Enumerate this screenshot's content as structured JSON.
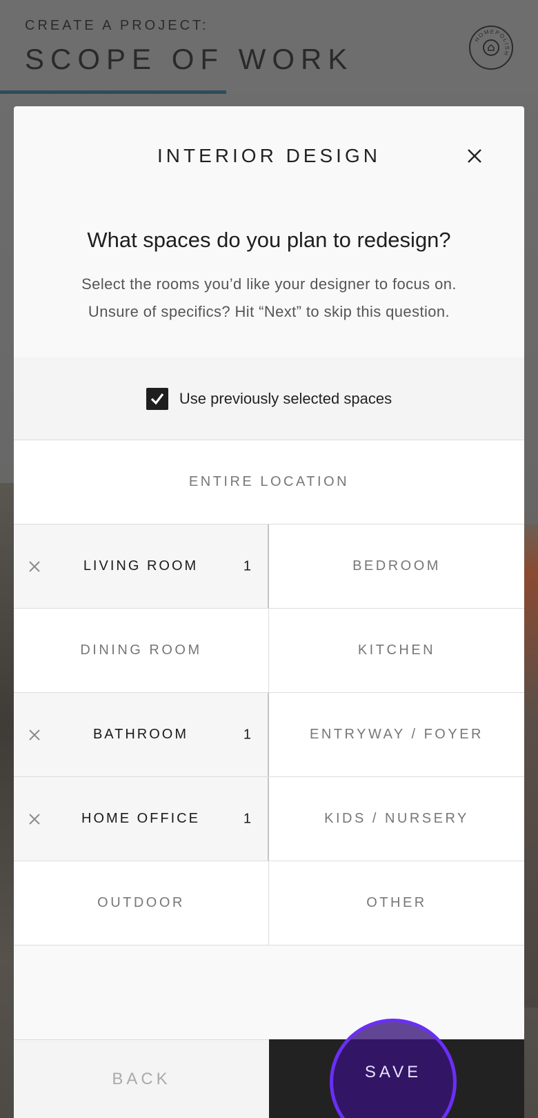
{
  "header": {
    "subtitle": "CREATE A PROJECT:",
    "title": "SCOPE OF WORK",
    "progress_fraction": 0.42,
    "logo_text": "HOMEPOLISH"
  },
  "modal": {
    "title": "INTERIOR DESIGN",
    "question": "What spaces do you plan to redesign?",
    "helper_line1": "Select the rooms you’d like your designer to focus on.",
    "helper_line2": "Unsure of specifics? Hit “Next” to skip this question.",
    "checkbox": {
      "label": "Use previously selected spaces",
      "checked": true
    },
    "entire_location": "ENTIRE LOCATION",
    "rooms": [
      {
        "label": "LIVING ROOM",
        "selected": true,
        "count": "1"
      },
      {
        "label": "BEDROOM",
        "selected": false
      },
      {
        "label": "DINING ROOM",
        "selected": false
      },
      {
        "label": "KITCHEN",
        "selected": false
      },
      {
        "label": "BATHROOM",
        "selected": true,
        "count": "1"
      },
      {
        "label": "ENTRYWAY / FOYER",
        "selected": false
      },
      {
        "label": "HOME OFFICE",
        "selected": true,
        "count": "1"
      },
      {
        "label": "KIDS / NURSERY",
        "selected": false
      },
      {
        "label": "OUTDOOR",
        "selected": false
      },
      {
        "label": "OTHER",
        "selected": false
      }
    ],
    "back_label": "BACK",
    "save_label": "SAVE"
  },
  "colors": {
    "accent": "#2f4c5c",
    "touch_ring": "#6a2ff5"
  }
}
